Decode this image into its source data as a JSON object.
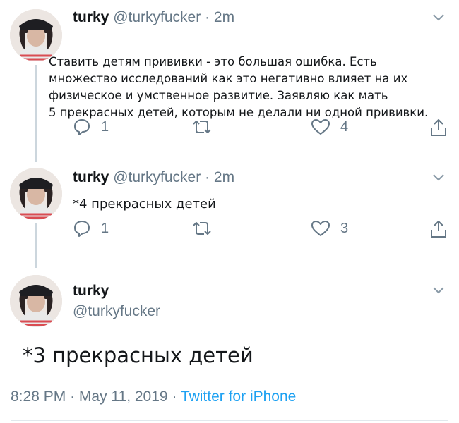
{
  "tweets": [
    {
      "name": "turky",
      "handle": "@turkyfucker",
      "separator": "·",
      "time": "2m",
      "text_lines": [
        "Ставить детям прививки - это большая ошибка. Есть",
        "множество исследований как это негативно влияет на их",
        "физическое и умственное развитие. Заявляю как мать",
        "5 прекрасных детей, которым не делали ни одной прививки."
      ],
      "replies": "1",
      "likes": "4"
    },
    {
      "name": "turky",
      "handle": "@turkyfucker",
      "separator": "·",
      "time": "2m",
      "text": "*4 прекрасных детей",
      "replies": "1",
      "likes": "3"
    }
  ],
  "main_tweet": {
    "name": "turky",
    "handle": "@turkyfucker",
    "text": "*3 прекрасных детей",
    "time": "8:28 PM",
    "date": "May 11, 2019",
    "separator": "·",
    "source": "Twitter for iPhone"
  },
  "icons": {
    "reply": "reply-icon",
    "retweet": "retweet-icon",
    "like": "heart-icon",
    "share": "share-icon",
    "menu": "chevron-down-icon"
  },
  "colors": {
    "text": "#14171a",
    "muted": "#657786",
    "link": "#1da1f2",
    "thread_line": "#ccd6dd"
  }
}
